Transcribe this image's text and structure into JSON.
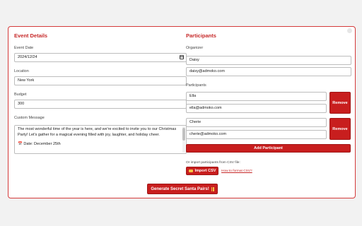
{
  "event": {
    "title": "Event Details",
    "date_label": "Event Date",
    "date_value": "2024/12/24",
    "location_label": "Location",
    "location_value": "New York",
    "budget_label": "Budget",
    "budget_value": "300",
    "message_label": "Custom Message",
    "message_paragraph1": "The most wonderful time of the year is here, and we're excited to invite you to our Christmas Party! Let's gather for a magical evening filled with joy, laughter, and holiday cheer.",
    "message_paragraph2": "📅 Date: December 25th"
  },
  "participants": {
    "title": "Participants",
    "organizer_label": "Organizer",
    "organizer_name": "Daisy",
    "organizer_email": "daisy@admoko.com",
    "list_label": "Participants",
    "people": [
      {
        "name": "Ella",
        "email": "ella@admoko.com"
      },
      {
        "name": "Cherie",
        "email": "cherie@admoko.com"
      }
    ],
    "remove_label": "Remove",
    "add_label": "Add Participant",
    "import_hint": "Or import participants from CSV file:",
    "import_label": "Import CSV",
    "format_link": "How to format CSV?"
  },
  "generate_label": "Generate Secret Santa Pairs!",
  "colors": {
    "accent": "#c81e1e",
    "border": "#d43a3a"
  },
  "icons": [
    "calendar-icon",
    "folder-icon",
    "pause-icon",
    "close-icon"
  ]
}
